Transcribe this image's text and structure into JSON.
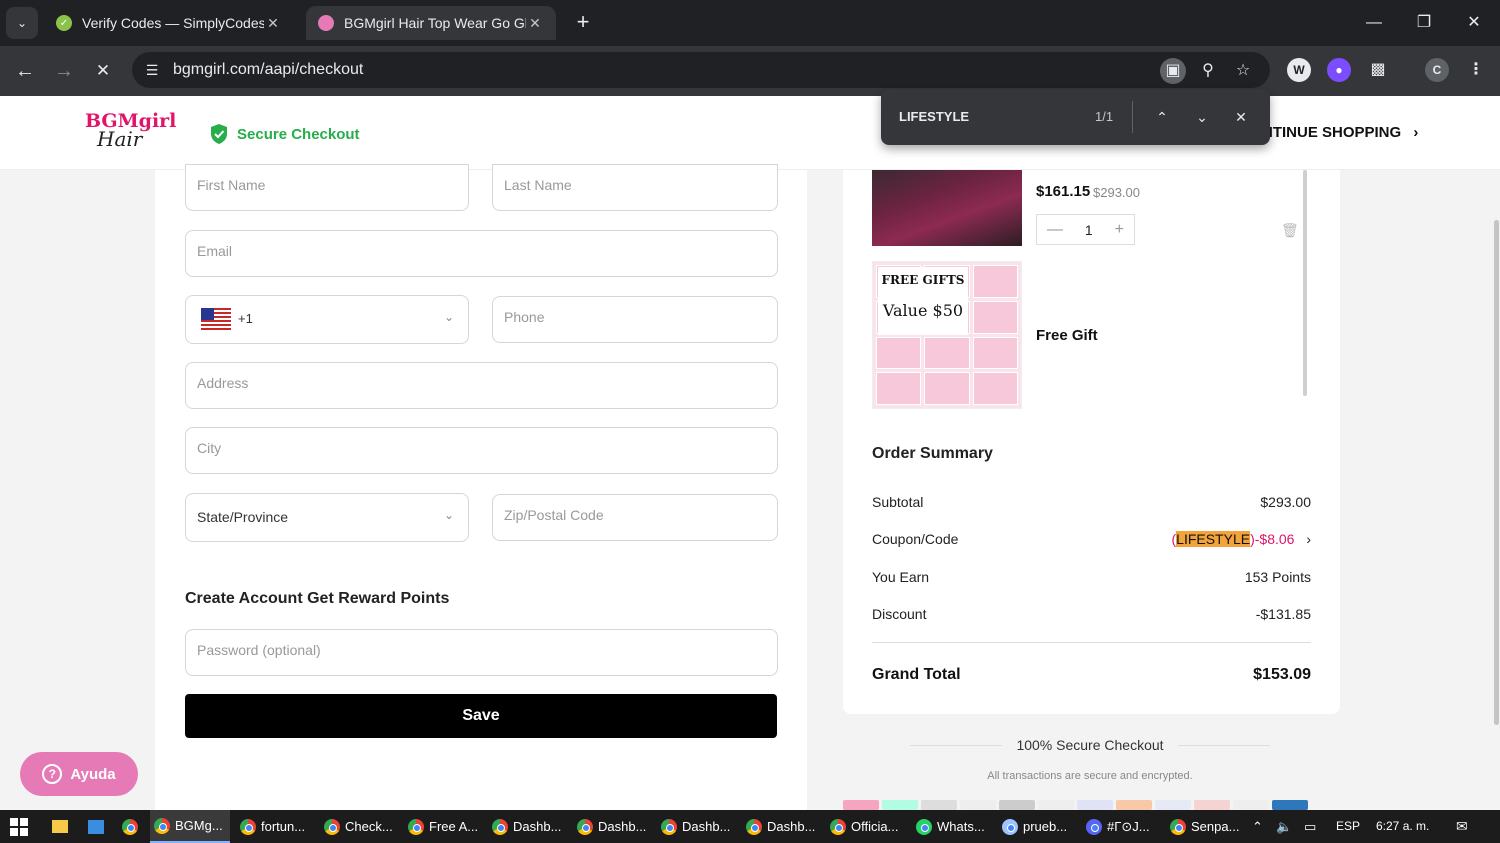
{
  "browser": {
    "tabs": [
      {
        "title": "Verify Codes — SimplyCodes",
        "active": false
      },
      {
        "title": "BGMgirl Hair Top Wear Go Glue",
        "active": true
      }
    ],
    "url": "bgmgirl.com/aapi/checkout",
    "profile_initial": "C"
  },
  "find_bar": {
    "query": "LIFESTYLE",
    "count": "1/1"
  },
  "header": {
    "logo_line1": "BGMgirl",
    "logo_line2": "Hair",
    "secure_label": "Secure Checkout",
    "continue_label": "NTINUE SHOPPING"
  },
  "form": {
    "first_name_placeholder": "First Name",
    "last_name_placeholder": "Last Name",
    "email_placeholder": "Email",
    "country_code": "+1",
    "phone_placeholder": "Phone",
    "address_placeholder": "Address",
    "city_placeholder": "City",
    "state_value": "State/Province",
    "zip_placeholder": "Zip/Postal Code",
    "account_title": "Create Account Get Reward Points",
    "password_placeholder": "Password (optional)",
    "save_label": "Save"
  },
  "help": {
    "label": "Ayuda"
  },
  "cart": {
    "price": "$161.15",
    "old_price": "$293.00",
    "quantity": "1",
    "gift_label": "Free Gift",
    "gift_image_title": "FREE GIFTS",
    "gift_image_value": "Value $50"
  },
  "summary": {
    "title": "Order Summary",
    "subtotal_label": "Subtotal",
    "subtotal_value": "$293.00",
    "coupon_label": "Coupon/Code",
    "coupon_open": "(",
    "coupon_code": "LIFESTYLE",
    "coupon_discount": ")-$8.06",
    "earn_label": "You Earn",
    "earn_value": "153 Points",
    "discount_label": "Discount",
    "discount_value": "-$131.85",
    "grand_label": "Grand Total",
    "grand_value": "$153.09"
  },
  "footer": {
    "secure": "100% Secure Checkout",
    "note": "All transactions are secure and encrypted."
  },
  "taskbar": {
    "items": [
      "BGMg...",
      "fortun...",
      "Check...",
      "Free A...",
      "Dashb...",
      "Dashb...",
      "Dashb...",
      "Dashb...",
      "Officia...",
      "Whats...",
      "prueb...",
      "#Γ⊙J...",
      "Senpa..."
    ],
    "lang": "ESP",
    "time": "6:27 a. m."
  },
  "colors": {
    "brand_pink": "#e0156a",
    "secure_green": "#27ae4a",
    "highlight_orange": "#f3a33b"
  }
}
